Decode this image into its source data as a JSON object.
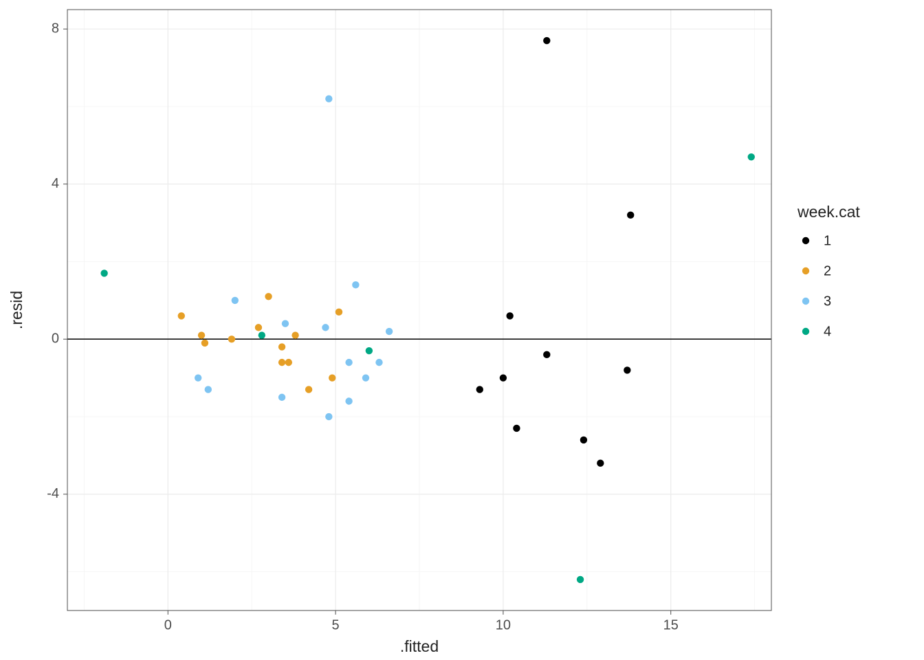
{
  "chart_data": {
    "type": "scatter",
    "title": "",
    "xlabel": ".fitted",
    "ylabel": ".resid",
    "xlim": [
      -3,
      18
    ],
    "ylim": [
      -7,
      8.5
    ],
    "x_ticks": [
      0,
      5,
      10,
      15
    ],
    "y_ticks": [
      -4,
      0,
      4,
      8
    ],
    "hline_y": 0,
    "legend": {
      "title": "week.cat",
      "entries": [
        {
          "label": "1",
          "color": "#000000"
        },
        {
          "label": "2",
          "color": "#E69F26"
        },
        {
          "label": "3",
          "color": "#7EC4F2"
        },
        {
          "label": "4",
          "color": "#00A884"
        }
      ]
    },
    "series": [
      {
        "name": "1",
        "color": "#000000",
        "points": [
          {
            "x": 11.3,
            "y": 7.7
          },
          {
            "x": 13.8,
            "y": 3.2
          },
          {
            "x": 10.2,
            "y": 0.6
          },
          {
            "x": 11.3,
            "y": -0.4
          },
          {
            "x": 13.7,
            "y": -0.8
          },
          {
            "x": 10.0,
            "y": -1.0
          },
          {
            "x": 9.3,
            "y": -1.3
          },
          {
            "x": 10.4,
            "y": -2.3
          },
          {
            "x": 12.4,
            "y": -2.6
          },
          {
            "x": 12.9,
            "y": -3.2
          }
        ]
      },
      {
        "name": "2",
        "color": "#E69F26",
        "points": [
          {
            "x": 0.4,
            "y": 0.6
          },
          {
            "x": 1.0,
            "y": 0.1
          },
          {
            "x": 1.1,
            "y": -0.1
          },
          {
            "x": 1.9,
            "y": 0.0
          },
          {
            "x": 2.7,
            "y": 0.3
          },
          {
            "x": 3.0,
            "y": 1.1
          },
          {
            "x": 3.8,
            "y": 0.1
          },
          {
            "x": 3.4,
            "y": -0.2
          },
          {
            "x": 3.6,
            "y": -0.6
          },
          {
            "x": 3.4,
            "y": -0.6
          },
          {
            "x": 4.2,
            "y": -1.3
          },
          {
            "x": 4.9,
            "y": -1.0
          },
          {
            "x": 5.1,
            "y": 0.7
          }
        ]
      },
      {
        "name": "3",
        "color": "#7EC4F2",
        "points": [
          {
            "x": 0.9,
            "y": -1.0
          },
          {
            "x": 1.2,
            "y": -1.3
          },
          {
            "x": 2.0,
            "y": 1.0
          },
          {
            "x": 3.4,
            "y": -1.5
          },
          {
            "x": 3.5,
            "y": 0.4
          },
          {
            "x": 4.8,
            "y": 6.2
          },
          {
            "x": 4.7,
            "y": 0.3
          },
          {
            "x": 4.8,
            "y": -2.0
          },
          {
            "x": 5.4,
            "y": -0.6
          },
          {
            "x": 5.4,
            "y": -1.6
          },
          {
            "x": 5.6,
            "y": 1.4
          },
          {
            "x": 5.9,
            "y": -1.0
          },
          {
            "x": 6.3,
            "y": -0.6
          },
          {
            "x": 6.6,
            "y": 0.2
          }
        ]
      },
      {
        "name": "4",
        "color": "#00A884",
        "points": [
          {
            "x": -1.9,
            "y": 1.7
          },
          {
            "x": 2.8,
            "y": 0.1
          },
          {
            "x": 6.0,
            "y": -0.3
          },
          {
            "x": 12.3,
            "y": -6.2
          },
          {
            "x": 17.4,
            "y": 4.7
          }
        ]
      }
    ]
  }
}
